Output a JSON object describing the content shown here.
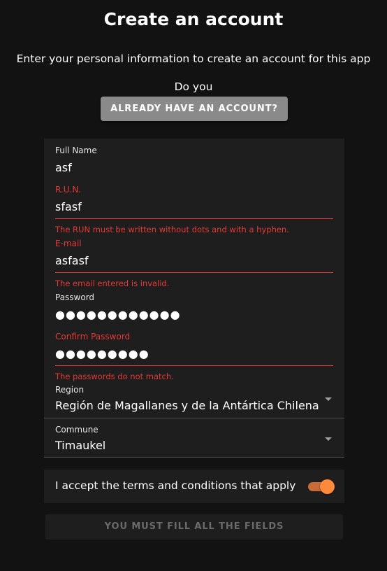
{
  "header": {
    "title": "Create an account",
    "subtitle": "Enter your personal information to create an account for this app",
    "prompt": "Do you",
    "login_button": "ALREADY HAVE AN ACCOUNT?"
  },
  "form": {
    "full_name": {
      "label": "Full Name",
      "value": "asf"
    },
    "run": {
      "label": "R.U.N.",
      "value": "sfasf",
      "error": "The RUN must be written without dots and with a hyphen."
    },
    "email": {
      "label": "E-mail",
      "value": "asfasf",
      "error": "The email entered is invalid."
    },
    "password": {
      "label": "Password",
      "value": "●●●●●●●●●●●●"
    },
    "confirm_password": {
      "label": "Confirm Password",
      "value": "●●●●●●●●●",
      "error": "The passwords do not match."
    },
    "region": {
      "label": "Region",
      "value": "Región de Magallanes y de la Antártica Chilena"
    },
    "commune": {
      "label": "Commune",
      "value": "Timaukel"
    }
  },
  "terms": {
    "label": "I accept the terms and conditions that apply",
    "checked": true
  },
  "submit": {
    "label": "YOU MUST FILL ALL THE FIELDS"
  },
  "colors": {
    "error": "#e53935",
    "accent": "#ff8a3c",
    "background": "#121212",
    "panel": "#1e1e1e"
  }
}
